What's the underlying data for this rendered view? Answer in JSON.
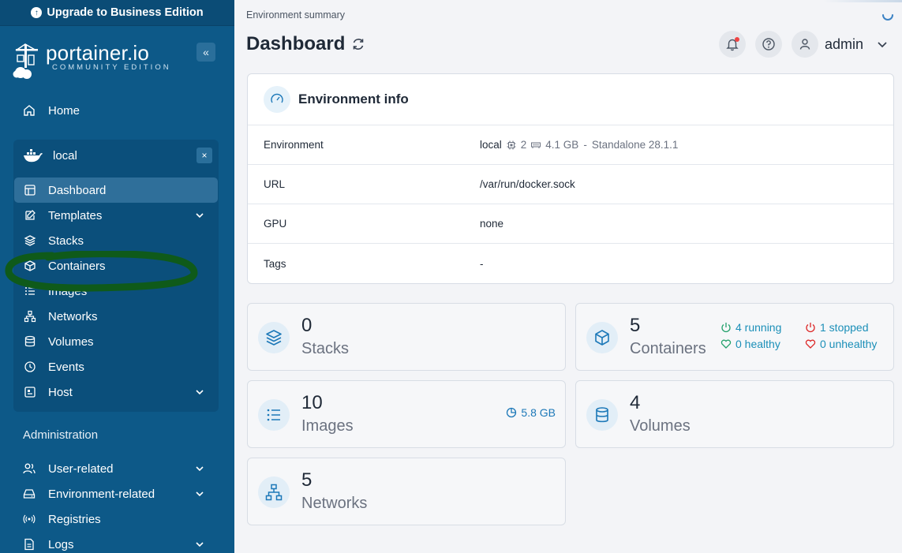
{
  "sidebar": {
    "upgrade_label": "Upgrade to Business Edition",
    "brand_name": "portainer.io",
    "brand_sub": "COMMUNITY EDITION",
    "home": "Home",
    "environment": {
      "name": "local",
      "items": [
        {
          "label": "Dashboard",
          "icon": "dashboard-icon"
        },
        {
          "label": "Templates",
          "icon": "templates-icon"
        },
        {
          "label": "Stacks",
          "icon": "stacks-icon"
        },
        {
          "label": "Containers",
          "icon": "containers-icon"
        },
        {
          "label": "Images",
          "icon": "images-icon"
        },
        {
          "label": "Networks",
          "icon": "networks-icon"
        },
        {
          "label": "Volumes",
          "icon": "volumes-icon"
        },
        {
          "label": "Events",
          "icon": "events-icon"
        },
        {
          "label": "Host",
          "icon": "host-icon"
        }
      ]
    },
    "admin_title": "Administration",
    "admin_items": [
      {
        "label": "User-related"
      },
      {
        "label": "Environment-related"
      },
      {
        "label": "Registries"
      },
      {
        "label": "Logs"
      }
    ]
  },
  "header": {
    "breadcrumb": "Environment summary",
    "title": "Dashboard",
    "user": "admin"
  },
  "env_info": {
    "title": "Environment info",
    "rows": [
      {
        "key": "Environment",
        "name": "local",
        "cpu": "2",
        "memory": "4.1 GB",
        "sep": "-",
        "type": "Standalone 28.1.1"
      },
      {
        "key": "URL",
        "value": "/var/run/docker.sock"
      },
      {
        "key": "GPU",
        "value": "none"
      },
      {
        "key": "Tags",
        "value": "-"
      }
    ]
  },
  "stats": {
    "stacks": {
      "count": "0",
      "label": "Stacks"
    },
    "containers": {
      "count": "5",
      "label": "Containers",
      "running": "4 running",
      "stopped": "1 stopped",
      "healthy": "0 healthy",
      "unhealthy": "0 unhealthy"
    },
    "images": {
      "count": "10",
      "label": "Images",
      "size": "5.8 GB"
    },
    "volumes": {
      "count": "4",
      "label": "Volumes"
    },
    "networks": {
      "count": "5",
      "label": "Networks"
    }
  },
  "colors": {
    "sidebar_bg": "#0d5988",
    "accent": "#1c78b8",
    "running": "#22a06b",
    "stopped": "#dc2626",
    "highlight_marker": "#0f5a1a"
  }
}
